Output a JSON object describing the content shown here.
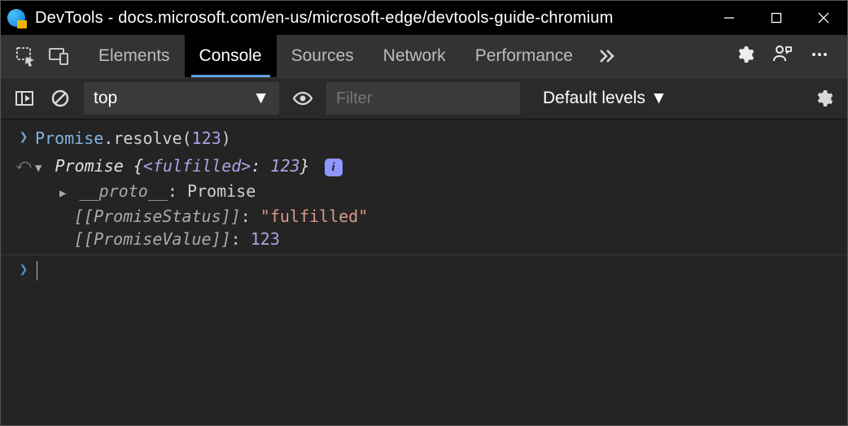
{
  "titlebar": {
    "title": "DevTools - docs.microsoft.com/en-us/microsoft-edge/devtools-guide-chromium"
  },
  "tabs": {
    "elements": "Elements",
    "console": "Console",
    "sources": "Sources",
    "network": "Network",
    "performance": "Performance"
  },
  "toolbar": {
    "context": "top",
    "filter_placeholder": "Filter",
    "levels": "Default levels"
  },
  "console": {
    "input1": {
      "obj": "Promise",
      "method": ".resolve(",
      "arg": "123",
      "close": ")"
    },
    "output1": {
      "head_obj": "Promise",
      "head_open": " {",
      "head_state": "<fulfilled>",
      "head_sep": ": ",
      "head_val": "123",
      "head_close": "}",
      "proto_key": "__proto__",
      "proto_sep": ": ",
      "proto_val": "Promise",
      "status_key": "[[PromiseStatus]]",
      "status_sep": ": ",
      "status_val": "\"fulfilled\"",
      "value_key": "[[PromiseValue]]",
      "value_sep": ": ",
      "value_val": "123"
    }
  }
}
